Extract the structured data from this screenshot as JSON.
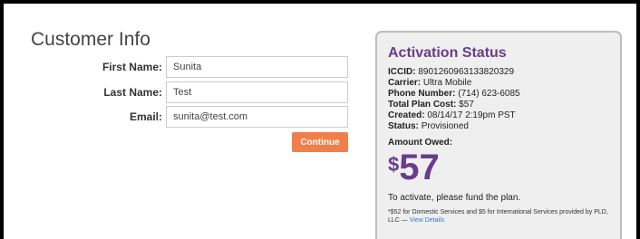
{
  "customer": {
    "title": "Customer Info",
    "fields": [
      {
        "label": "First Name:",
        "value": "Sunita"
      },
      {
        "label": "Last Name:",
        "value": "Test"
      },
      {
        "label": "Email:",
        "value": "sunita@test.com"
      }
    ],
    "continue_label": "Continue"
  },
  "activation": {
    "title": "Activation Status",
    "items": [
      {
        "label": "ICCID:",
        "value": "8901260963133820329"
      },
      {
        "label": "Carrier:",
        "value": "Ultra Mobile"
      },
      {
        "label": "Phone Number:",
        "value": "(714) 623-6085"
      },
      {
        "label": "Total Plan Cost:",
        "value": "$57"
      },
      {
        "label": "Created:",
        "value": "08/14/17 2:19pm PST"
      },
      {
        "label": "Status:",
        "value": "Provisioned"
      }
    ],
    "amount_label": "Amount Owed:",
    "amount_currency": "$",
    "amount_value": "57",
    "activate_message": "To activate, please fund the plan.",
    "footnote_text": "*$52 for Domestic Services and $5 for International Services provided by PLD, LLC — ",
    "footnote_link": "View Details"
  },
  "colors": {
    "accent_purple": "#6a3c8c",
    "button_orange": "#f07f4a",
    "link_blue": "#2a7bd0"
  }
}
